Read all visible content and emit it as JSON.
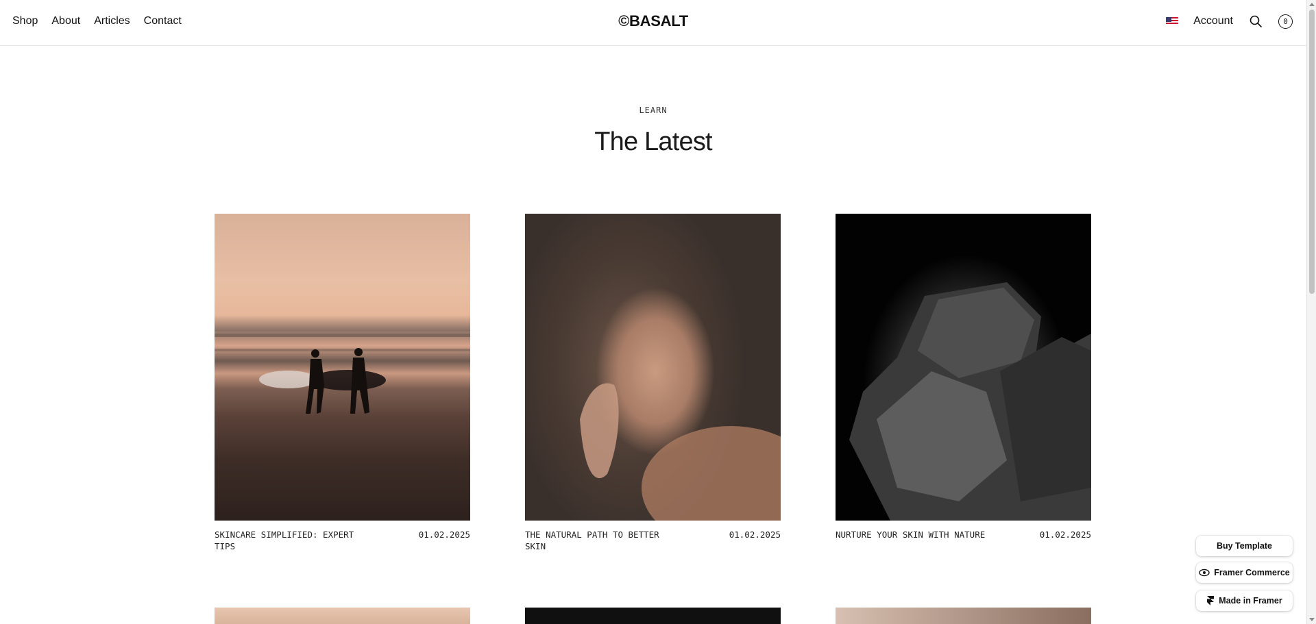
{
  "nav": {
    "links": [
      "Shop",
      "About",
      "Articles",
      "Contact"
    ],
    "logo": "©BASALT",
    "account": "Account",
    "cart_count": "0"
  },
  "hero": {
    "eyebrow": "LEARN",
    "title": "The Latest"
  },
  "articles": [
    {
      "title": "SKINCARE SIMPLIFIED: EXPERT TIPS",
      "date": "01.02.2025",
      "image": "two surfers walking on beach at sunset"
    },
    {
      "title": "THE NATURAL PATH TO BETTER SKIN",
      "date": "01.02.2025",
      "image": "woman portrait with hand on chin"
    },
    {
      "title": "NURTURE YOUR SKIN WITH NATURE",
      "date": "01.02.2025",
      "image": "dark volcanic rocks on black background"
    }
  ],
  "floating": {
    "buy": "Buy Template",
    "commerce": "Framer Commerce",
    "made": "Made in Framer"
  },
  "icons": [
    "flag-us-icon",
    "search-icon",
    "cart-icon",
    "framer-commerce-icon",
    "framer-icon"
  ],
  "colors": {
    "text": "#111111",
    "border": "#e6e6e6",
    "background": "#ffffff"
  }
}
